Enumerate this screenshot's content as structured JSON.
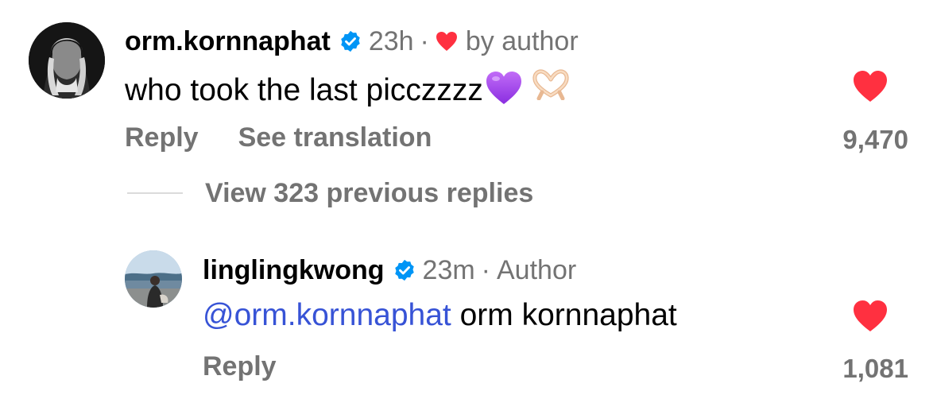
{
  "colors": {
    "like_red": "#ff3040",
    "verified_blue": "#0095f6",
    "secondary_text": "#737373",
    "mention_blue": "#3753d6"
  },
  "comment": {
    "username": "orm.kornnaphat",
    "verified": true,
    "time": "23h",
    "separator": "·",
    "liked_by_author_label": "by author",
    "text": "who took the last picczzzz",
    "emojis": [
      "purple-heart-icon",
      "heart-hands-icon"
    ],
    "reply_label": "Reply",
    "translation_label": "See translation",
    "likes": "9,470",
    "liked": true
  },
  "view_replies_label": "View 323 previous replies",
  "reply": {
    "username": "linglingkwong",
    "verified": true,
    "time": "23m",
    "separator": "·",
    "author_label": "Author",
    "mention": "@orm.kornnaphat",
    "text": " orm kornnaphat",
    "reply_label": "Reply",
    "likes": "1,081",
    "liked": true
  }
}
